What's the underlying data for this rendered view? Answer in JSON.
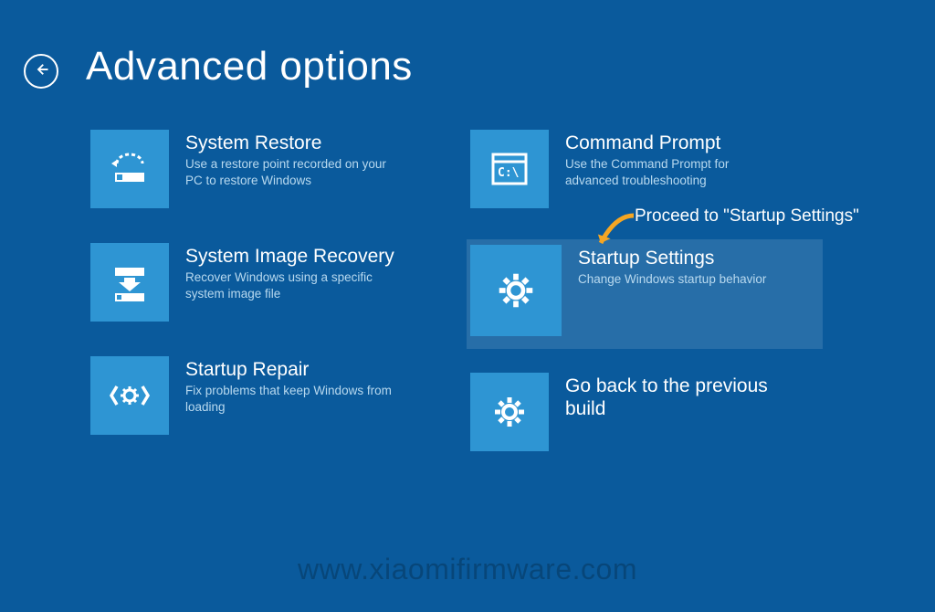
{
  "header": {
    "back_icon": "←",
    "title": "Advanced options"
  },
  "tiles": {
    "system_restore": {
      "title": "System Restore",
      "desc": "Use a restore point recorded on your PC to restore Windows"
    },
    "system_image_recovery": {
      "title": "System Image Recovery",
      "desc": "Recover Windows using a specific system image file"
    },
    "startup_repair": {
      "title": "Startup Repair",
      "desc": "Fix problems that keep Windows from loading"
    },
    "command_prompt": {
      "title": "Command Prompt",
      "desc": "Use the Command Prompt for advanced troubleshooting"
    },
    "startup_settings": {
      "title": "Startup Settings",
      "desc": "Change Windows startup behavior"
    },
    "go_back": {
      "title": "Go back to the previous build",
      "desc": ""
    }
  },
  "annotation": {
    "text": "Proceed to \"Startup Settings\""
  },
  "watermark": "www.xiaomifirmware.com"
}
